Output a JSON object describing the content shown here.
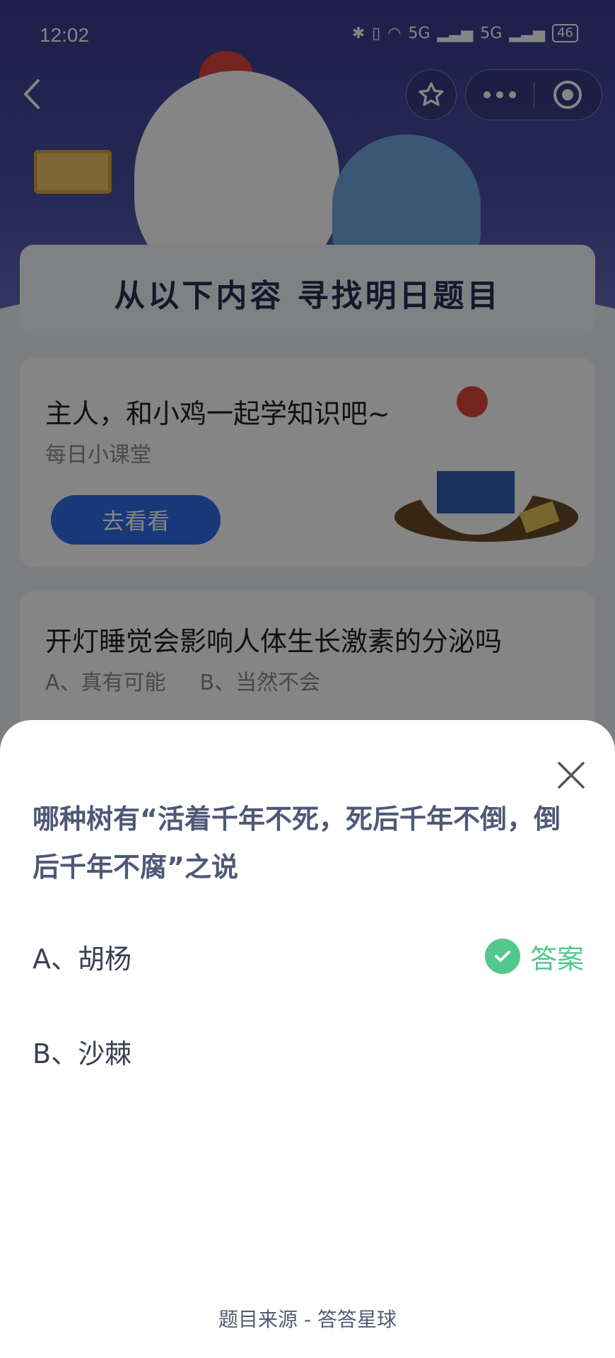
{
  "status_bar": {
    "time": "12:02",
    "network_1": "5G",
    "network_2": "5G",
    "battery": "46"
  },
  "background": {
    "banner_title": "从以下内容  寻找明日题目",
    "card1": {
      "title": "主人，和小鸡一起学知识吧~",
      "subtitle": "每日小课堂",
      "button_label": "去看看"
    },
    "card2": {
      "question": "开灯睡觉会影响人体生长激素的分泌吗",
      "option_a": "A、真有可能",
      "option_b": "B、当然不会"
    }
  },
  "sheet": {
    "question": "哪种树有“活着千年不死，死后千年不倒，倒后千年不腐”之说",
    "options": [
      {
        "label": "A、胡杨",
        "is_answer": true
      },
      {
        "label": "B、沙棘",
        "is_answer": false
      }
    ],
    "answer_label": "答案",
    "source": "题目来源 - 答答星球"
  },
  "colors": {
    "accent_green": "#52c88c",
    "question_text": "#4f5877",
    "primary_blue": "#2f6be8"
  },
  "icons": [
    "back-icon",
    "star-icon",
    "more-dots-icon",
    "target-icon",
    "close-icon",
    "check-icon"
  ]
}
